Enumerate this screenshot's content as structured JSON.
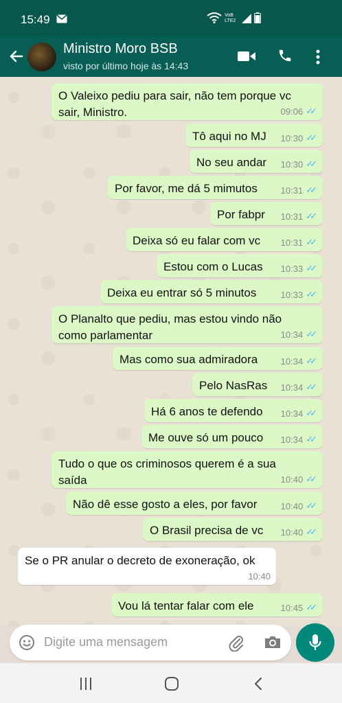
{
  "statusbar": {
    "time": "15:49",
    "network_label": "VoB LTE2"
  },
  "header": {
    "contact_name": "Ministro Moro BSB",
    "last_seen": "visto por último hoje às 14:43"
  },
  "messages": [
    {
      "dir": "out",
      "text": "O Valeixo pediu para sair, não tem porque vc\nsair, Ministro.",
      "time": "09:06"
    },
    {
      "dir": "out",
      "text": "Tô aqui no MJ",
      "time": "10:30"
    },
    {
      "dir": "out",
      "text": "No seu andar",
      "time": "10:30"
    },
    {
      "dir": "out",
      "text": "Por favor, me dá 5 mimutos",
      "time": "10:31"
    },
    {
      "dir": "out",
      "text": "Por fabpr",
      "time": "10:31"
    },
    {
      "dir": "out",
      "text": "Deixa só eu falar com vc",
      "time": "10:31"
    },
    {
      "dir": "out",
      "text": "Estou com o Lucas",
      "time": "10:33"
    },
    {
      "dir": "out",
      "text": "Deixa eu entrar só 5 minutos",
      "time": "10:33"
    },
    {
      "dir": "out",
      "text": "O Planalto que pediu, mas estou vindo não\ncomo parlamentar",
      "time": "10:34"
    },
    {
      "dir": "out",
      "text": "Mas como sua admiradora",
      "time": "10:34"
    },
    {
      "dir": "out",
      "text": "Pelo NasRas",
      "time": "10:34"
    },
    {
      "dir": "out",
      "text": "Há 6 anos te defendo",
      "time": "10:34"
    },
    {
      "dir": "out",
      "text": "Me ouve só um pouco",
      "time": "10:34"
    },
    {
      "dir": "out",
      "text": "Tudo o que os criminosos querem é a sua\nsaída",
      "time": "10:40"
    },
    {
      "dir": "out",
      "text": "Não dê esse gosto a eles,  por favor",
      "time": "10:40"
    },
    {
      "dir": "out",
      "text": "O Brasil precisa de vc",
      "time": "10:40"
    },
    {
      "dir": "in",
      "text": "Se o PR anular o decreto de exoneração, ok",
      "time": "10:40"
    },
    {
      "dir": "out",
      "text": "Vou lá tentar falar com ele",
      "time": "10:45"
    }
  ],
  "composer": {
    "placeholder": "Digite uma mensagem"
  },
  "colors": {
    "header": "#075e54",
    "outgoing_bubble": "#dcf8c6",
    "incoming_bubble": "#ffffff",
    "read_ticks": "#4fb6ec",
    "fab": "#00897b"
  },
  "icons": [
    "message-icon",
    "wifi-icon",
    "signal-icon",
    "battery-icon",
    "back-arrow-icon",
    "video-call-icon",
    "phone-icon",
    "more-icon",
    "emoji-icon",
    "attach-icon",
    "camera-icon",
    "mic-icon",
    "recents-icon",
    "home-icon",
    "nav-back-icon"
  ]
}
